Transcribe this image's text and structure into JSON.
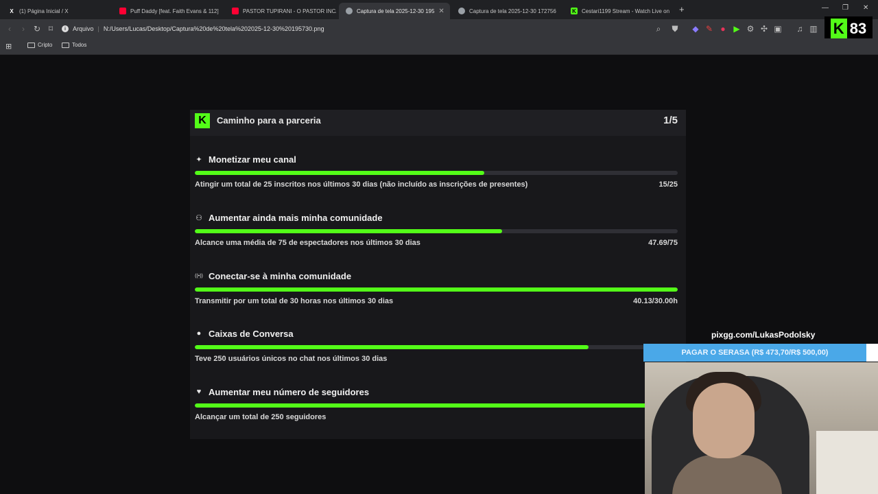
{
  "browser": {
    "tabs": [
      {
        "label": "(1) Página Inicial / X",
        "favicon": "X",
        "fav_color": "#ffffff"
      },
      {
        "label": "Puff Daddy [feat. Faith Evans & 112]",
        "favicon": "",
        "fav_color": "#ff0033"
      },
      {
        "label": "PASTOR TUPIRANI - O PASTOR INCA",
        "favicon": "",
        "fav_color": "#ff0033"
      },
      {
        "label": "Captura de tela 2025-12-30 195",
        "favicon": "",
        "fav_color": "#9aa0a6"
      },
      {
        "label": "Captura de tela 2025-12-30 172756",
        "favicon": "",
        "fav_color": "#9aa0a6"
      },
      {
        "label": "Cestari1199 Stream - Watch Live on",
        "favicon": "K",
        "fav_color": "#53fc18"
      }
    ],
    "address_label": "Arquivo",
    "address_url": "N:/Users/Lucas/Desktop/Captura%20de%20tela%202025-12-30%20195730.png",
    "bookmarks": [
      "Cripto",
      "Todos"
    ],
    "badge_number": "83"
  },
  "card": {
    "title": "Caminho para a parceria",
    "step": "1/5",
    "goals": [
      {
        "icon": "✦",
        "title": "Monetizar meu canal",
        "desc": "Atingir um total de 25 inscritos nos últimos 30 dias (não incluído as inscrições de presentes)",
        "value": "15/25",
        "progress": 0.6
      },
      {
        "icon": "⚇",
        "title": "Aumentar ainda mais minha comunidade",
        "desc": "Alcance uma média de 75 de espectadores nos últimos 30 dias",
        "value": "47.69/75",
        "progress": 0.636
      },
      {
        "icon": "((•))",
        "title": "Conectar-se à minha comunidade",
        "desc": "Transmitir por um total de 30 horas nos últimos 30 dias",
        "value": "40.13/30.00h",
        "progress": 1.0
      },
      {
        "icon": "●",
        "title": "Caixas de Conversa",
        "desc": "Teve 250 usuários únicos no chat nos últimos 30 dias",
        "value": "",
        "progress": 0.815
      },
      {
        "icon": "♥",
        "title": "Aumentar meu número de seguidores",
        "desc": "Alcançar um total de 250 seguidores",
        "value": "",
        "progress": 1.0
      }
    ]
  },
  "overlay": {
    "pix": "pixgg.com/LukasPodolsky",
    "donation_goal": "PAGAR O SERASA (R$ 473,70/R$ 500,00)"
  }
}
